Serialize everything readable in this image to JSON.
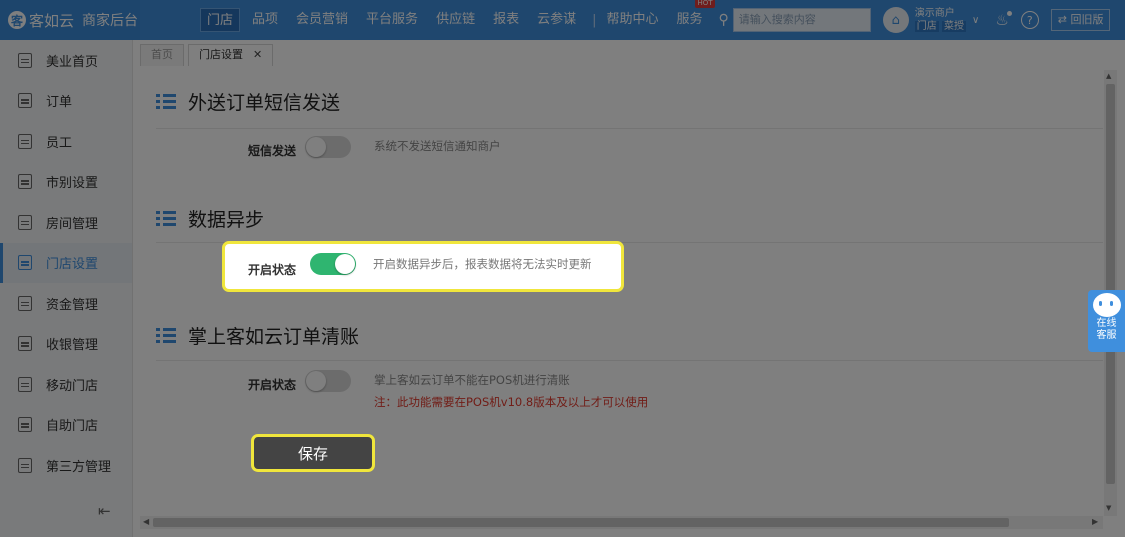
{
  "brand": {
    "logo_text": "客如云",
    "subtitle": "商家后台"
  },
  "nav": {
    "items": [
      "门店",
      "品项",
      "会员营销",
      "平台服务",
      "供应链",
      "报表",
      "云参谋"
    ],
    "active": "门店",
    "help": "帮助中心",
    "service": "服务",
    "service_badge": "HOT",
    "search_placeholder": "请输入搜索内容"
  },
  "account": {
    "name": "演示商户",
    "tags": [
      "门店",
      "菜授"
    ]
  },
  "back_old_label": "⇄ 回旧版",
  "sidebar": {
    "items": [
      "美业首页",
      "订单",
      "员工",
      "市别设置",
      "房间管理",
      "门店设置",
      "资金管理",
      "收银管理",
      "移动门店",
      "自助门店",
      "第三方管理"
    ],
    "active": "门店设置"
  },
  "tabs": {
    "home": "首页",
    "current": "门店设置"
  },
  "sections": {
    "sms": {
      "title": "外送订单短信发送",
      "label": "短信发送",
      "enabled": false,
      "desc": "系统不发送短信通知商户"
    },
    "async": {
      "title": "数据异步",
      "label": "开启状态",
      "enabled": true,
      "desc": "开启数据异步后，报表数据将无法实时更新"
    },
    "clear": {
      "title": "掌上客如云订单清账",
      "label": "开启状态",
      "enabled": false,
      "desc": "掌上客如云订单不能在POS机进行清账",
      "warning": "注：此功能需要在POS机v10.8版本及以上才可以使用"
    }
  },
  "save_label": "保存",
  "online_service": [
    "在线",
    "客服"
  ],
  "colors": {
    "primary": "#3f8fdd",
    "toggle_on": "#2fb570",
    "warning": "#e23b2e",
    "highlight": "#f0e63c"
  }
}
